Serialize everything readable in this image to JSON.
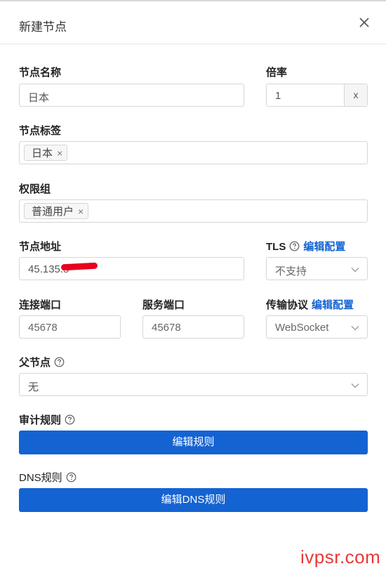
{
  "header": {
    "title": "新建节点"
  },
  "form": {
    "node_name": {
      "label": "节点名称",
      "value": "日本"
    },
    "rate": {
      "label": "倍率",
      "value": "1",
      "suffix": "x"
    },
    "node_tags": {
      "label": "节点标签",
      "tags": [
        "日本"
      ]
    },
    "permission_group": {
      "label": "权限组",
      "tags": [
        "普通用户"
      ]
    },
    "node_address": {
      "label": "节点地址",
      "value": "45.135.5"
    },
    "tls": {
      "label": "TLS",
      "link": "编辑配置",
      "value": "不支持"
    },
    "connect_port": {
      "label": "连接端口",
      "value": "45678"
    },
    "service_port": {
      "label": "服务端口",
      "value": "45678"
    },
    "transport": {
      "label": "传输协议",
      "link": "编辑配置",
      "value": "WebSocket"
    },
    "parent_node": {
      "label": "父节点",
      "value": "无"
    },
    "audit_rules": {
      "label": "审计规则",
      "button": "编辑规则"
    },
    "dns_rules": {
      "label": "DNS规则",
      "button": "编辑DNS规则"
    }
  },
  "icons": {
    "close": "close-icon",
    "help": "help-circle-icon",
    "chevron": "chevron-down-icon",
    "tag_remove": "tag-remove-icon"
  },
  "colors": {
    "primary": "#1463d2",
    "link": "#1463d2",
    "watermark": "#e63a3a"
  },
  "watermark": "ivpsr.com"
}
